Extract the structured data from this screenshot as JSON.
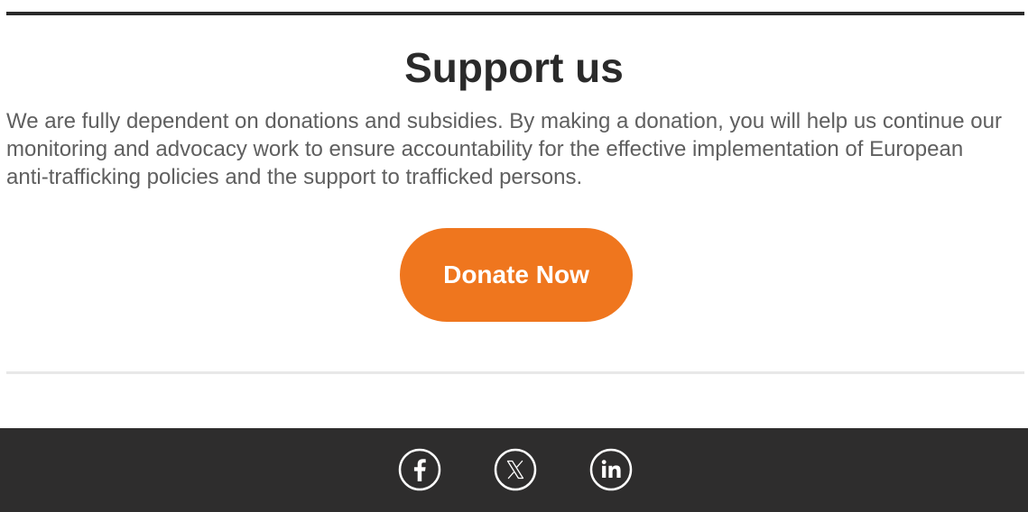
{
  "support": {
    "title": "Support us",
    "body": "We are fully dependent on donations and subsidies. By making a donation, you will help us continue our monitoring and advocacy work to ensure accountability for the effective implementation of European anti-trafficking policies and the support to trafficked persons.",
    "donate_label": "Donate Now"
  },
  "footer": {
    "social": [
      {
        "icon": "facebook-icon"
      },
      {
        "icon": "x-icon"
      },
      {
        "icon": "linkedin-icon"
      }
    ]
  },
  "colors": {
    "accent": "#ef761e",
    "heading": "#2a2a2a",
    "body_text": "#5f5f5f",
    "footer_bg": "#2e2d2d",
    "divider": "#e8e8e8"
  }
}
